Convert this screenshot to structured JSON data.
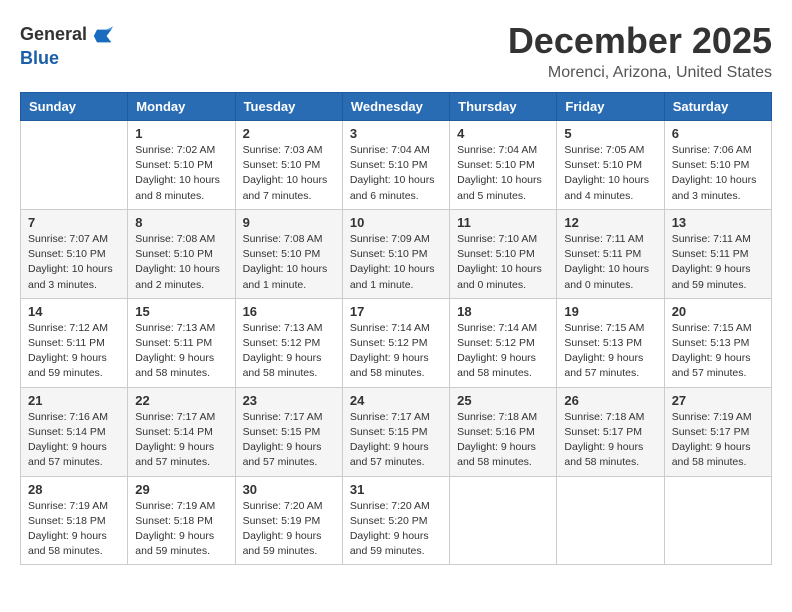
{
  "header": {
    "logo_general": "General",
    "logo_blue": "Blue",
    "month": "December 2025",
    "location": "Morenci, Arizona, United States"
  },
  "weekdays": [
    "Sunday",
    "Monday",
    "Tuesday",
    "Wednesday",
    "Thursday",
    "Friday",
    "Saturday"
  ],
  "weeks": [
    [
      {
        "day": "",
        "info": ""
      },
      {
        "day": "1",
        "info": "Sunrise: 7:02 AM\nSunset: 5:10 PM\nDaylight: 10 hours\nand 8 minutes."
      },
      {
        "day": "2",
        "info": "Sunrise: 7:03 AM\nSunset: 5:10 PM\nDaylight: 10 hours\nand 7 minutes."
      },
      {
        "day": "3",
        "info": "Sunrise: 7:04 AM\nSunset: 5:10 PM\nDaylight: 10 hours\nand 6 minutes."
      },
      {
        "day": "4",
        "info": "Sunrise: 7:04 AM\nSunset: 5:10 PM\nDaylight: 10 hours\nand 5 minutes."
      },
      {
        "day": "5",
        "info": "Sunrise: 7:05 AM\nSunset: 5:10 PM\nDaylight: 10 hours\nand 4 minutes."
      },
      {
        "day": "6",
        "info": "Sunrise: 7:06 AM\nSunset: 5:10 PM\nDaylight: 10 hours\nand 3 minutes."
      }
    ],
    [
      {
        "day": "7",
        "info": "Sunrise: 7:07 AM\nSunset: 5:10 PM\nDaylight: 10 hours\nand 3 minutes."
      },
      {
        "day": "8",
        "info": "Sunrise: 7:08 AM\nSunset: 5:10 PM\nDaylight: 10 hours\nand 2 minutes."
      },
      {
        "day": "9",
        "info": "Sunrise: 7:08 AM\nSunset: 5:10 PM\nDaylight: 10 hours\nand 1 minute."
      },
      {
        "day": "10",
        "info": "Sunrise: 7:09 AM\nSunset: 5:10 PM\nDaylight: 10 hours\nand 1 minute."
      },
      {
        "day": "11",
        "info": "Sunrise: 7:10 AM\nSunset: 5:10 PM\nDaylight: 10 hours\nand 0 minutes."
      },
      {
        "day": "12",
        "info": "Sunrise: 7:11 AM\nSunset: 5:11 PM\nDaylight: 10 hours\nand 0 minutes."
      },
      {
        "day": "13",
        "info": "Sunrise: 7:11 AM\nSunset: 5:11 PM\nDaylight: 9 hours\nand 59 minutes."
      }
    ],
    [
      {
        "day": "14",
        "info": "Sunrise: 7:12 AM\nSunset: 5:11 PM\nDaylight: 9 hours\nand 59 minutes."
      },
      {
        "day": "15",
        "info": "Sunrise: 7:13 AM\nSunset: 5:11 PM\nDaylight: 9 hours\nand 58 minutes."
      },
      {
        "day": "16",
        "info": "Sunrise: 7:13 AM\nSunset: 5:12 PM\nDaylight: 9 hours\nand 58 minutes."
      },
      {
        "day": "17",
        "info": "Sunrise: 7:14 AM\nSunset: 5:12 PM\nDaylight: 9 hours\nand 58 minutes."
      },
      {
        "day": "18",
        "info": "Sunrise: 7:14 AM\nSunset: 5:12 PM\nDaylight: 9 hours\nand 58 minutes."
      },
      {
        "day": "19",
        "info": "Sunrise: 7:15 AM\nSunset: 5:13 PM\nDaylight: 9 hours\nand 57 minutes."
      },
      {
        "day": "20",
        "info": "Sunrise: 7:15 AM\nSunset: 5:13 PM\nDaylight: 9 hours\nand 57 minutes."
      }
    ],
    [
      {
        "day": "21",
        "info": "Sunrise: 7:16 AM\nSunset: 5:14 PM\nDaylight: 9 hours\nand 57 minutes."
      },
      {
        "day": "22",
        "info": "Sunrise: 7:17 AM\nSunset: 5:14 PM\nDaylight: 9 hours\nand 57 minutes."
      },
      {
        "day": "23",
        "info": "Sunrise: 7:17 AM\nSunset: 5:15 PM\nDaylight: 9 hours\nand 57 minutes."
      },
      {
        "day": "24",
        "info": "Sunrise: 7:17 AM\nSunset: 5:15 PM\nDaylight: 9 hours\nand 57 minutes."
      },
      {
        "day": "25",
        "info": "Sunrise: 7:18 AM\nSunset: 5:16 PM\nDaylight: 9 hours\nand 58 minutes."
      },
      {
        "day": "26",
        "info": "Sunrise: 7:18 AM\nSunset: 5:17 PM\nDaylight: 9 hours\nand 58 minutes."
      },
      {
        "day": "27",
        "info": "Sunrise: 7:19 AM\nSunset: 5:17 PM\nDaylight: 9 hours\nand 58 minutes."
      }
    ],
    [
      {
        "day": "28",
        "info": "Sunrise: 7:19 AM\nSunset: 5:18 PM\nDaylight: 9 hours\nand 58 minutes."
      },
      {
        "day": "29",
        "info": "Sunrise: 7:19 AM\nSunset: 5:18 PM\nDaylight: 9 hours\nand 59 minutes."
      },
      {
        "day": "30",
        "info": "Sunrise: 7:20 AM\nSunset: 5:19 PM\nDaylight: 9 hours\nand 59 minutes."
      },
      {
        "day": "31",
        "info": "Sunrise: 7:20 AM\nSunset: 5:20 PM\nDaylight: 9 hours\nand 59 minutes."
      },
      {
        "day": "",
        "info": ""
      },
      {
        "day": "",
        "info": ""
      },
      {
        "day": "",
        "info": ""
      }
    ]
  ]
}
